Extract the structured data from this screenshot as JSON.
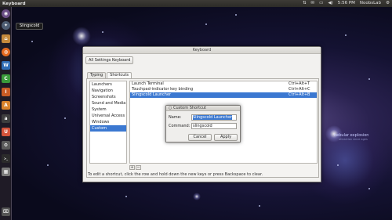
{
  "top_panel": {
    "app_title": "Keyboard",
    "tray": {
      "network_icon": "network-icon",
      "mail_icon": "mail-icon",
      "battery_icon": "battery-icon",
      "volume_icon": "volume-icon",
      "clock": "5:56 PM",
      "user": "NoobsLab",
      "settings_icon": "gear-icon"
    }
  },
  "launcher": {
    "tooltip": "Slingscold",
    "items": [
      {
        "name": "dash",
        "glyph": "◉",
        "color": "#6b4f86"
      },
      {
        "name": "slingscold",
        "glyph": "✦",
        "color": "#4f5d74"
      },
      {
        "name": "home-folder",
        "glyph": "⌂",
        "color": "#c68a3c"
      },
      {
        "name": "firefox",
        "glyph": "◍",
        "color": "#e46a20"
      },
      {
        "name": "libreoffice-writer",
        "glyph": "W",
        "color": "#2f6db5"
      },
      {
        "name": "libreoffice-calc",
        "glyph": "C",
        "color": "#3a9a3a"
      },
      {
        "name": "libreoffice-impress",
        "glyph": "I",
        "color": "#c85b24"
      },
      {
        "name": "software-center",
        "glyph": "A",
        "color": "#d9822b"
      },
      {
        "name": "amazon",
        "glyph": "a",
        "color": "#3e3e3e"
      },
      {
        "name": "ubuntu-one",
        "glyph": "U",
        "color": "#d4533a"
      },
      {
        "name": "system-settings",
        "glyph": "⚙",
        "color": "#5a5a5a"
      },
      {
        "name": "terminal",
        "glyph": ">_",
        "color": "#2b2b2b"
      },
      {
        "name": "workspaces",
        "glyph": "▦",
        "color": "#7b7b7b"
      },
      {
        "name": "trash",
        "glyph": "🗑",
        "color": "#555"
      }
    ]
  },
  "window": {
    "title": "Keyboard",
    "all_settings": "All Settings  Keyboard",
    "tabs": [
      "Typing",
      "Shortcuts"
    ],
    "categories": [
      "Launchers",
      "Navigation",
      "Screenshots",
      "Sound and Media",
      "System",
      "Universal Access",
      "Windows",
      "Custom Shortcuts"
    ],
    "selected_category": 7,
    "shortcuts": [
      {
        "name": "Launch Terminal",
        "keys": "Ctrl+Alt+T"
      },
      {
        "name": "Touchpad-indicator key binding",
        "keys": "Ctrl+Alt+C"
      },
      {
        "name": "Slingscold Launcher",
        "keys": "Ctrl+Alt+B"
      }
    ],
    "selected_shortcut": 2,
    "add_label": "+",
    "remove_label": "−",
    "hint": "To edit a shortcut, click the row and hold down the new keys or press Backspace to clear."
  },
  "dialog": {
    "title": "Custom Shortcut",
    "name_label": "Name:",
    "name_value": "Slingscold Launcher",
    "command_label": "Command:",
    "command_value": "slingscold",
    "cancel_label": "Cancel",
    "apply_label": "Apply"
  },
  "wallpaper": {
    "title": "nebular explosion",
    "subtitle": "attraction since ages"
  }
}
